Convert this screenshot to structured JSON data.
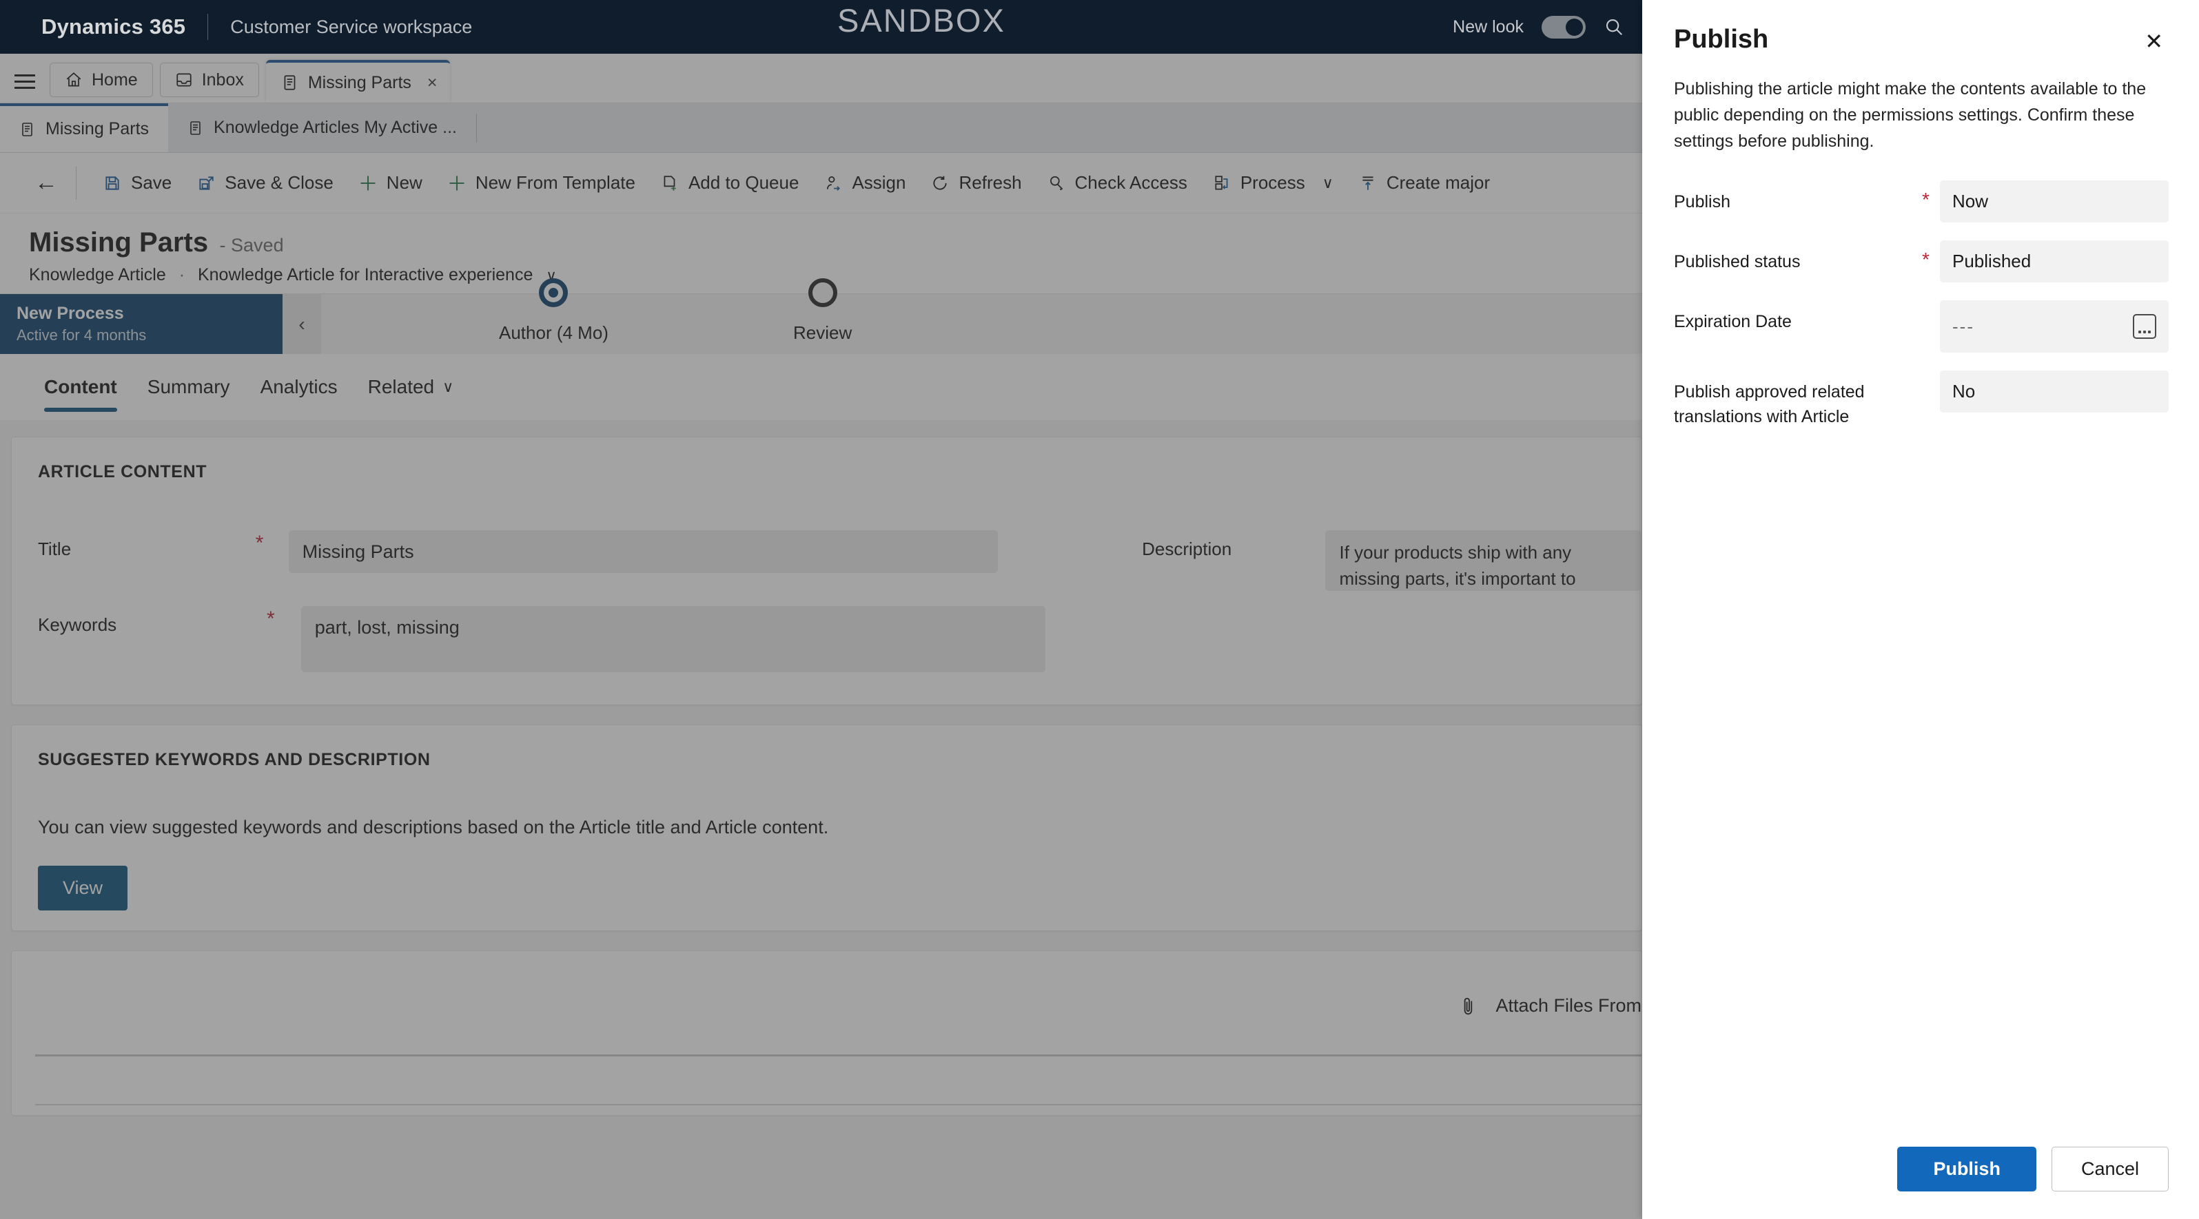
{
  "nav": {
    "brand": "Dynamics 365",
    "app_name": "Customer Service workspace",
    "environment_banner": "SANDBOX",
    "new_look_label": "New look",
    "new_look_on": true,
    "search_icon": "search-icon"
  },
  "app_tabs": [
    {
      "label": "Home",
      "icon": "home-icon",
      "active": false,
      "closable": false
    },
    {
      "label": "Inbox",
      "icon": "inbox-icon",
      "active": false,
      "closable": false
    },
    {
      "label": "Missing Parts",
      "icon": "article-icon",
      "active": true,
      "closable": true,
      "close_glyph": "×"
    }
  ],
  "session_tabs": [
    {
      "label": "Missing Parts",
      "icon": "article-icon",
      "active": true
    },
    {
      "label": "Knowledge Articles My Active ...",
      "icon": "article-icon",
      "active": false
    }
  ],
  "command_bar": {
    "back_glyph": "←",
    "commands": [
      {
        "label": "Save",
        "icon": "save-icon"
      },
      {
        "label": "Save & Close",
        "icon": "save-close-icon"
      },
      {
        "label": "New",
        "icon": "plus-icon"
      },
      {
        "label": "New From Template",
        "icon": "plus-icon"
      },
      {
        "label": "Add to Queue",
        "icon": "add-to-queue-icon"
      },
      {
        "label": "Assign",
        "icon": "assign-person-icon"
      },
      {
        "label": "Refresh",
        "icon": "refresh-icon"
      },
      {
        "label": "Check Access",
        "icon": "check-access-key-icon"
      },
      {
        "label": "Process",
        "icon": "process-icon",
        "has_chevron": true,
        "chevron": "∨"
      },
      {
        "label": "Create major",
        "icon": "create-major-version-icon"
      }
    ]
  },
  "record": {
    "title": "Missing Parts",
    "save_state": "- Saved",
    "entity": "Knowledge Article",
    "separator": "·",
    "form_name": "Knowledge Article for Interactive experience",
    "form_chevron": "∨"
  },
  "process_flow": {
    "name": "New Process",
    "active_for": "Active for 4 months",
    "prev_glyph": "‹",
    "stages": [
      {
        "label": "Author  (4 Mo)",
        "state": "current"
      },
      {
        "label": "Review",
        "state": "future"
      }
    ]
  },
  "form_tabs": [
    {
      "label": "Content",
      "active": true
    },
    {
      "label": "Summary",
      "active": false
    },
    {
      "label": "Analytics",
      "active": false
    },
    {
      "label": "Related",
      "active": false,
      "chevron": "∨"
    }
  ],
  "article_content": {
    "section_header": "ARTICLE CONTENT",
    "title_label": "Title",
    "title_required": "*",
    "title_value": "Missing Parts",
    "keywords_label": "Keywords",
    "keywords_required": "*",
    "keywords_value": "part, lost, missing",
    "description_label": "Description",
    "description_value": "If your products ship with any missing parts, it's important to replace those as soon as possible"
  },
  "suggested": {
    "section_header": "SUGGESTED KEYWORDS AND DESCRIPTION",
    "paragraph": "You can view suggested keywords and descriptions based on the Article title and Article content.",
    "view_button": "View"
  },
  "attachments": {
    "attach_label": "Attach Files From",
    "attach_icon": "paperclip-icon"
  },
  "publish_panel": {
    "title": "Publish",
    "close_glyph": "✕",
    "description": "Publishing the article might make the contents available to the public depending on the permissions settings. Confirm these settings before publishing.",
    "fields": [
      {
        "label": "Publish",
        "required": "*",
        "value": "Now",
        "has_calendar": false
      },
      {
        "label": "Published status",
        "required": "*",
        "value": "Published",
        "has_calendar": false
      },
      {
        "label": "Expiration Date",
        "required": "",
        "value": "---",
        "muted": true,
        "has_calendar": true,
        "calendar_icon": "calendar-icon"
      },
      {
        "label": "Publish approved related translations with Article",
        "required": "",
        "value": "No",
        "has_calendar": false
      }
    ],
    "primary_button": "Publish",
    "secondary_button": "Cancel"
  },
  "colors": {
    "nav_background": "#0b1a2b",
    "accent_blue": "#1268ba",
    "process_blue": "#12456f",
    "tab_underline": "#12557f",
    "required_red": "#b9273a",
    "field_background": "#ededed",
    "panel_field_background": "#f2f2f2"
  }
}
